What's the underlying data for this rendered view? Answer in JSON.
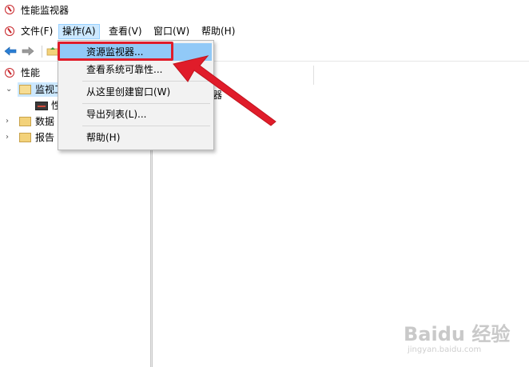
{
  "window": {
    "title": "性能监视器"
  },
  "menubar": {
    "items": [
      {
        "label": "文件(F)"
      },
      {
        "label": "操作(A)"
      },
      {
        "label": "查看(V)"
      },
      {
        "label": "窗口(W)"
      },
      {
        "label": "帮助(H)"
      }
    ]
  },
  "toolbar": {
    "back_icon": "back-arrow-icon",
    "forward_icon": "forward-arrow-icon",
    "up_icon": "folder-up-icon"
  },
  "tree": {
    "items": [
      {
        "label": "性能"
      },
      {
        "label": "监视工"
      },
      {
        "label": "性"
      },
      {
        "label": "数据"
      },
      {
        "label": "报告"
      }
    ]
  },
  "right_pane": {
    "text": "器"
  },
  "dropdown": {
    "items": [
      {
        "label": "资源监视器..."
      },
      {
        "label": "查看系统可靠性..."
      },
      {
        "label": "从这里创建窗口(W)"
      },
      {
        "label": "导出列表(L)..."
      },
      {
        "label": "帮助(H)"
      }
    ]
  },
  "colors": {
    "highlight": "#e01c2a",
    "menu_hover": "#91c9f7",
    "active_menu": "#cce8ff"
  },
  "watermark": {
    "text": "Baidu 经验",
    "sub": "jingyan.baidu.com"
  }
}
